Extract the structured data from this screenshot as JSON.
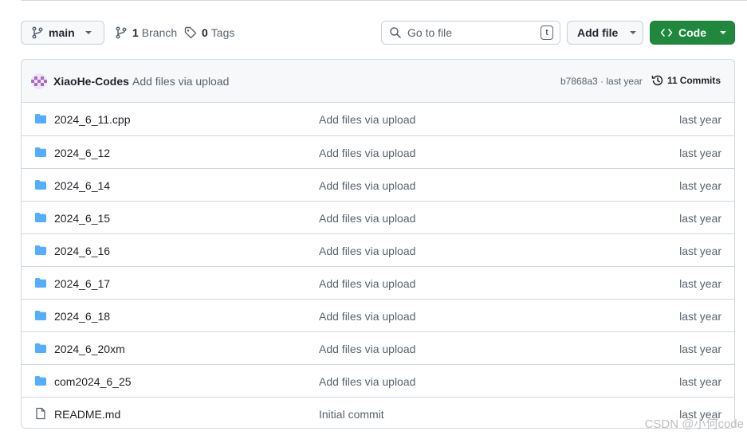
{
  "toolbar": {
    "branch_name": "main",
    "branches_count": "1",
    "branches_label": "Branch",
    "tags_count": "0",
    "tags_label": "Tags",
    "goto_placeholder": "Go to file",
    "goto_shortcut": "t",
    "add_file_label": "Add file",
    "code_label": "Code"
  },
  "latest_commit": {
    "author": "XiaoHe-Codes",
    "message": "Add files via upload",
    "sha_time": "b7868a3 · last year",
    "commits_count": "11",
    "commits_label": "Commits"
  },
  "files": [
    {
      "type": "folder",
      "name": "2024_6_11.cpp",
      "message": "Add files via upload",
      "time": "last year"
    },
    {
      "type": "folder",
      "name": "2024_6_12",
      "message": "Add files via upload",
      "time": "last year"
    },
    {
      "type": "folder",
      "name": "2024_6_14",
      "message": "Add files via upload",
      "time": "last year"
    },
    {
      "type": "folder",
      "name": "2024_6_15",
      "message": "Add files via upload",
      "time": "last year"
    },
    {
      "type": "folder",
      "name": "2024_6_16",
      "message": "Add files via upload",
      "time": "last year"
    },
    {
      "type": "folder",
      "name": "2024_6_17",
      "message": "Add files via upload",
      "time": "last year"
    },
    {
      "type": "folder",
      "name": "2024_6_18",
      "message": "Add files via upload",
      "time": "last year"
    },
    {
      "type": "folder",
      "name": "2024_6_20xm",
      "message": "Add files via upload",
      "time": "last year"
    },
    {
      "type": "folder",
      "name": "com2024_6_25",
      "message": "Add files via upload",
      "time": "last year"
    },
    {
      "type": "file",
      "name": "README.md",
      "message": "Initial commit",
      "time": "last year"
    }
  ],
  "icons": {
    "folder": "folder-icon",
    "file": "file-icon"
  },
  "colors": {
    "folder": "#54aeff",
    "primary_button": "#1f883d",
    "muted_text": "#59636e"
  },
  "watermark": "CSDN @小何code"
}
